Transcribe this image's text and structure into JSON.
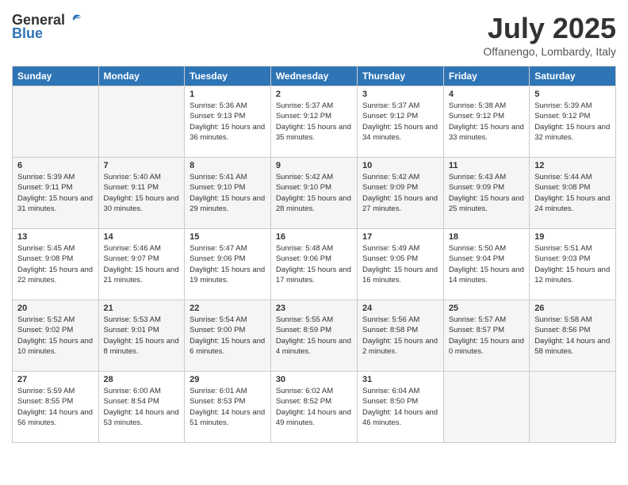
{
  "logo": {
    "general": "General",
    "blue": "Blue"
  },
  "header": {
    "month": "July 2025",
    "location": "Offanengo, Lombardy, Italy"
  },
  "weekdays": [
    "Sunday",
    "Monday",
    "Tuesday",
    "Wednesday",
    "Thursday",
    "Friday",
    "Saturday"
  ],
  "weeks": [
    [
      {
        "day": "",
        "info": ""
      },
      {
        "day": "",
        "info": ""
      },
      {
        "day": "1",
        "info": "Sunrise: 5:36 AM\nSunset: 9:13 PM\nDaylight: 15 hours and 36 minutes."
      },
      {
        "day": "2",
        "info": "Sunrise: 5:37 AM\nSunset: 9:12 PM\nDaylight: 15 hours and 35 minutes."
      },
      {
        "day": "3",
        "info": "Sunrise: 5:37 AM\nSunset: 9:12 PM\nDaylight: 15 hours and 34 minutes."
      },
      {
        "day": "4",
        "info": "Sunrise: 5:38 AM\nSunset: 9:12 PM\nDaylight: 15 hours and 33 minutes."
      },
      {
        "day": "5",
        "info": "Sunrise: 5:39 AM\nSunset: 9:12 PM\nDaylight: 15 hours and 32 minutes."
      }
    ],
    [
      {
        "day": "6",
        "info": "Sunrise: 5:39 AM\nSunset: 9:11 PM\nDaylight: 15 hours and 31 minutes."
      },
      {
        "day": "7",
        "info": "Sunrise: 5:40 AM\nSunset: 9:11 PM\nDaylight: 15 hours and 30 minutes."
      },
      {
        "day": "8",
        "info": "Sunrise: 5:41 AM\nSunset: 9:10 PM\nDaylight: 15 hours and 29 minutes."
      },
      {
        "day": "9",
        "info": "Sunrise: 5:42 AM\nSunset: 9:10 PM\nDaylight: 15 hours and 28 minutes."
      },
      {
        "day": "10",
        "info": "Sunrise: 5:42 AM\nSunset: 9:09 PM\nDaylight: 15 hours and 27 minutes."
      },
      {
        "day": "11",
        "info": "Sunrise: 5:43 AM\nSunset: 9:09 PM\nDaylight: 15 hours and 25 minutes."
      },
      {
        "day": "12",
        "info": "Sunrise: 5:44 AM\nSunset: 9:08 PM\nDaylight: 15 hours and 24 minutes."
      }
    ],
    [
      {
        "day": "13",
        "info": "Sunrise: 5:45 AM\nSunset: 9:08 PM\nDaylight: 15 hours and 22 minutes."
      },
      {
        "day": "14",
        "info": "Sunrise: 5:46 AM\nSunset: 9:07 PM\nDaylight: 15 hours and 21 minutes."
      },
      {
        "day": "15",
        "info": "Sunrise: 5:47 AM\nSunset: 9:06 PM\nDaylight: 15 hours and 19 minutes."
      },
      {
        "day": "16",
        "info": "Sunrise: 5:48 AM\nSunset: 9:06 PM\nDaylight: 15 hours and 17 minutes."
      },
      {
        "day": "17",
        "info": "Sunrise: 5:49 AM\nSunset: 9:05 PM\nDaylight: 15 hours and 16 minutes."
      },
      {
        "day": "18",
        "info": "Sunrise: 5:50 AM\nSunset: 9:04 PM\nDaylight: 15 hours and 14 minutes."
      },
      {
        "day": "19",
        "info": "Sunrise: 5:51 AM\nSunset: 9:03 PM\nDaylight: 15 hours and 12 minutes."
      }
    ],
    [
      {
        "day": "20",
        "info": "Sunrise: 5:52 AM\nSunset: 9:02 PM\nDaylight: 15 hours and 10 minutes."
      },
      {
        "day": "21",
        "info": "Sunrise: 5:53 AM\nSunset: 9:01 PM\nDaylight: 15 hours and 8 minutes."
      },
      {
        "day": "22",
        "info": "Sunrise: 5:54 AM\nSunset: 9:00 PM\nDaylight: 15 hours and 6 minutes."
      },
      {
        "day": "23",
        "info": "Sunrise: 5:55 AM\nSunset: 8:59 PM\nDaylight: 15 hours and 4 minutes."
      },
      {
        "day": "24",
        "info": "Sunrise: 5:56 AM\nSunset: 8:58 PM\nDaylight: 15 hours and 2 minutes."
      },
      {
        "day": "25",
        "info": "Sunrise: 5:57 AM\nSunset: 8:57 PM\nDaylight: 15 hours and 0 minutes."
      },
      {
        "day": "26",
        "info": "Sunrise: 5:58 AM\nSunset: 8:56 PM\nDaylight: 14 hours and 58 minutes."
      }
    ],
    [
      {
        "day": "27",
        "info": "Sunrise: 5:59 AM\nSunset: 8:55 PM\nDaylight: 14 hours and 56 minutes."
      },
      {
        "day": "28",
        "info": "Sunrise: 6:00 AM\nSunset: 8:54 PM\nDaylight: 14 hours and 53 minutes."
      },
      {
        "day": "29",
        "info": "Sunrise: 6:01 AM\nSunset: 8:53 PM\nDaylight: 14 hours and 51 minutes."
      },
      {
        "day": "30",
        "info": "Sunrise: 6:02 AM\nSunset: 8:52 PM\nDaylight: 14 hours and 49 minutes."
      },
      {
        "day": "31",
        "info": "Sunrise: 6:04 AM\nSunset: 8:50 PM\nDaylight: 14 hours and 46 minutes."
      },
      {
        "day": "",
        "info": ""
      },
      {
        "day": "",
        "info": ""
      }
    ]
  ]
}
